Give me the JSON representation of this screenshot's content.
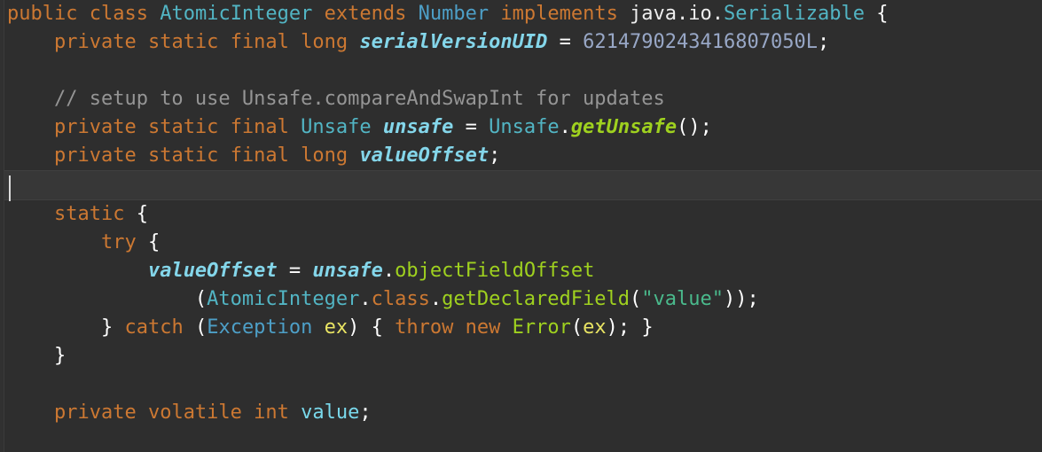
{
  "editor": {
    "kind": "code-editor",
    "language": "Java",
    "theme": "dark",
    "background_color": "#2e2e2e",
    "current_line_color": "#373737",
    "caret_color": "#dcdcdc",
    "font_size_px": 22,
    "line_height_px": 32,
    "palette": {
      "keyword": "#cc7832",
      "type": "#4d9fc7",
      "type_alt": "#52b5c4",
      "field_italic": "#84d6ea",
      "method": "#9fd11f",
      "comment": "#959595",
      "string": "#4aba8c",
      "number": "#98a7c6",
      "plain": "#eeeeee",
      "parameter": "#e9e463",
      "variable": "#7ad9ec"
    }
  },
  "code": {
    "lines": [
      {
        "id": 1,
        "current": false,
        "text": "public class AtomicInteger extends Number implements java.io.Serializable {",
        "tokens": [
          {
            "t": "public",
            "c": "t-kw"
          },
          {
            "t": " ",
            "c": "t-plain"
          },
          {
            "t": "class",
            "c": "t-kw"
          },
          {
            "t": " ",
            "c": "t-plain"
          },
          {
            "t": "AtomicInteger",
            "c": "t-type2"
          },
          {
            "t": " ",
            "c": "t-plain"
          },
          {
            "t": "extends",
            "c": "t-kw"
          },
          {
            "t": " ",
            "c": "t-plain"
          },
          {
            "t": "Number",
            "c": "t-type"
          },
          {
            "t": " ",
            "c": "t-plain"
          },
          {
            "t": "implements",
            "c": "t-kw"
          },
          {
            "t": " java.io.",
            "c": "t-plain"
          },
          {
            "t": "Serializable",
            "c": "t-type2"
          },
          {
            "t": " {",
            "c": "t-punc"
          }
        ]
      },
      {
        "id": 2,
        "current": false,
        "text": "    private static final long serialVersionUID = 6214790243416807050L;",
        "tokens": [
          {
            "t": "    ",
            "c": "t-plain"
          },
          {
            "t": "private",
            "c": "t-kw"
          },
          {
            "t": " ",
            "c": "t-plain"
          },
          {
            "t": "static",
            "c": "t-kw"
          },
          {
            "t": " ",
            "c": "t-plain"
          },
          {
            "t": "final",
            "c": "t-kw"
          },
          {
            "t": " ",
            "c": "t-plain"
          },
          {
            "t": "long",
            "c": "t-kw"
          },
          {
            "t": " ",
            "c": "t-plain"
          },
          {
            "t": "serialVersionUID",
            "c": "t-field"
          },
          {
            "t": " ",
            "c": "t-plain"
          },
          {
            "t": "=",
            "c": "t-punc"
          },
          {
            "t": " ",
            "c": "t-plain"
          },
          {
            "t": "6214790243416807050L",
            "c": "t-num"
          },
          {
            "t": ";",
            "c": "t-punc"
          }
        ]
      },
      {
        "id": 3,
        "current": false,
        "text": "",
        "tokens": []
      },
      {
        "id": 4,
        "current": false,
        "text": "    // setup to use Unsafe.compareAndSwapInt for updates",
        "tokens": [
          {
            "t": "    ",
            "c": "t-plain"
          },
          {
            "t": "// setup to use Unsafe.compareAndSwapInt for updates",
            "c": "t-comment"
          }
        ]
      },
      {
        "id": 5,
        "current": false,
        "text": "    private static final Unsafe unsafe = Unsafe.getUnsafe();",
        "tokens": [
          {
            "t": "    ",
            "c": "t-plain"
          },
          {
            "t": "private",
            "c": "t-kw"
          },
          {
            "t": " ",
            "c": "t-plain"
          },
          {
            "t": "static",
            "c": "t-kw"
          },
          {
            "t": " ",
            "c": "t-plain"
          },
          {
            "t": "final",
            "c": "t-kw"
          },
          {
            "t": " ",
            "c": "t-plain"
          },
          {
            "t": "Unsafe",
            "c": "t-type2"
          },
          {
            "t": " ",
            "c": "t-plain"
          },
          {
            "t": "unsafe",
            "c": "t-field"
          },
          {
            "t": " ",
            "c": "t-plain"
          },
          {
            "t": "=",
            "c": "t-punc"
          },
          {
            "t": " ",
            "c": "t-plain"
          },
          {
            "t": "Unsafe",
            "c": "t-type2"
          },
          {
            "t": ".",
            "c": "t-punc"
          },
          {
            "t": "getUnsafe",
            "c": "t-methodi"
          },
          {
            "t": "();",
            "c": "t-punc"
          }
        ]
      },
      {
        "id": 6,
        "current": false,
        "text": "    private static final long valueOffset;",
        "tokens": [
          {
            "t": "    ",
            "c": "t-plain"
          },
          {
            "t": "private",
            "c": "t-kw"
          },
          {
            "t": " ",
            "c": "t-plain"
          },
          {
            "t": "static",
            "c": "t-kw"
          },
          {
            "t": " ",
            "c": "t-plain"
          },
          {
            "t": "final",
            "c": "t-kw"
          },
          {
            "t": " ",
            "c": "t-plain"
          },
          {
            "t": "long",
            "c": "t-kw"
          },
          {
            "t": " ",
            "c": "t-plain"
          },
          {
            "t": "valueOffset",
            "c": "t-field"
          },
          {
            "t": ";",
            "c": "t-punc"
          }
        ]
      },
      {
        "id": 7,
        "current": true,
        "text": "",
        "tokens": []
      },
      {
        "id": 8,
        "current": false,
        "text": "    static {",
        "tokens": [
          {
            "t": "    ",
            "c": "t-plain"
          },
          {
            "t": "static",
            "c": "t-kw"
          },
          {
            "t": " {",
            "c": "t-punc"
          }
        ]
      },
      {
        "id": 9,
        "current": false,
        "text": "        try {",
        "tokens": [
          {
            "t": "        ",
            "c": "t-plain"
          },
          {
            "t": "try",
            "c": "t-kw"
          },
          {
            "t": " {",
            "c": "t-punc"
          }
        ]
      },
      {
        "id": 10,
        "current": false,
        "text": "            valueOffset = unsafe.objectFieldOffset",
        "tokens": [
          {
            "t": "            ",
            "c": "t-plain"
          },
          {
            "t": "valueOffset",
            "c": "t-field"
          },
          {
            "t": " ",
            "c": "t-plain"
          },
          {
            "t": "=",
            "c": "t-punc"
          },
          {
            "t": " ",
            "c": "t-plain"
          },
          {
            "t": "unsafe",
            "c": "t-field"
          },
          {
            "t": ".",
            "c": "t-punc"
          },
          {
            "t": "objectFieldOffset",
            "c": "t-method"
          }
        ]
      },
      {
        "id": 11,
        "current": false,
        "text": "                (AtomicInteger.class.getDeclaredField(\"value\"));",
        "tokens": [
          {
            "t": "                ",
            "c": "t-plain"
          },
          {
            "t": "(",
            "c": "t-punc"
          },
          {
            "t": "AtomicInteger",
            "c": "t-type2"
          },
          {
            "t": ".",
            "c": "t-punc"
          },
          {
            "t": "class",
            "c": "t-kw"
          },
          {
            "t": ".",
            "c": "t-punc"
          },
          {
            "t": "getDeclaredField",
            "c": "t-method"
          },
          {
            "t": "(",
            "c": "t-punc"
          },
          {
            "t": "\"value\"",
            "c": "t-str"
          },
          {
            "t": "));",
            "c": "t-punc"
          }
        ]
      },
      {
        "id": 12,
        "current": false,
        "text": "        } catch (Exception ex) { throw new Error(ex); }",
        "tokens": [
          {
            "t": "        ",
            "c": "t-plain"
          },
          {
            "t": "}",
            "c": "t-punc"
          },
          {
            "t": " ",
            "c": "t-plain"
          },
          {
            "t": "catch",
            "c": "t-kw"
          },
          {
            "t": " ",
            "c": "t-plain"
          },
          {
            "t": "(",
            "c": "t-punc"
          },
          {
            "t": "Exception",
            "c": "t-type"
          },
          {
            "t": " ",
            "c": "t-plain"
          },
          {
            "t": "ex",
            "c": "t-param"
          },
          {
            "t": ")",
            "c": "t-punc"
          },
          {
            "t": " {",
            "c": "t-punc"
          },
          {
            "t": " ",
            "c": "t-plain"
          },
          {
            "t": "throw",
            "c": "t-kw"
          },
          {
            "t": " ",
            "c": "t-plain"
          },
          {
            "t": "new",
            "c": "t-kw"
          },
          {
            "t": " ",
            "c": "t-plain"
          },
          {
            "t": "Error",
            "c": "t-method"
          },
          {
            "t": "(",
            "c": "t-punc"
          },
          {
            "t": "ex",
            "c": "t-param"
          },
          {
            "t": "); }",
            "c": "t-punc"
          }
        ]
      },
      {
        "id": 13,
        "current": false,
        "text": "    }",
        "tokens": [
          {
            "t": "    ",
            "c": "t-plain"
          },
          {
            "t": "}",
            "c": "t-punc"
          }
        ]
      },
      {
        "id": 14,
        "current": false,
        "text": "",
        "tokens": []
      },
      {
        "id": 15,
        "current": false,
        "text": "    private volatile int value;",
        "tokens": [
          {
            "t": "    ",
            "c": "t-plain"
          },
          {
            "t": "private",
            "c": "t-kw"
          },
          {
            "t": " ",
            "c": "t-plain"
          },
          {
            "t": "volatile",
            "c": "t-kw"
          },
          {
            "t": " ",
            "c": "t-plain"
          },
          {
            "t": "int",
            "c": "t-kw"
          },
          {
            "t": " ",
            "c": "t-plain"
          },
          {
            "t": "value",
            "c": "t-var"
          },
          {
            "t": ";",
            "c": "t-punc"
          }
        ]
      },
      {
        "id": 16,
        "current": false,
        "text": "",
        "tokens": []
      }
    ]
  }
}
